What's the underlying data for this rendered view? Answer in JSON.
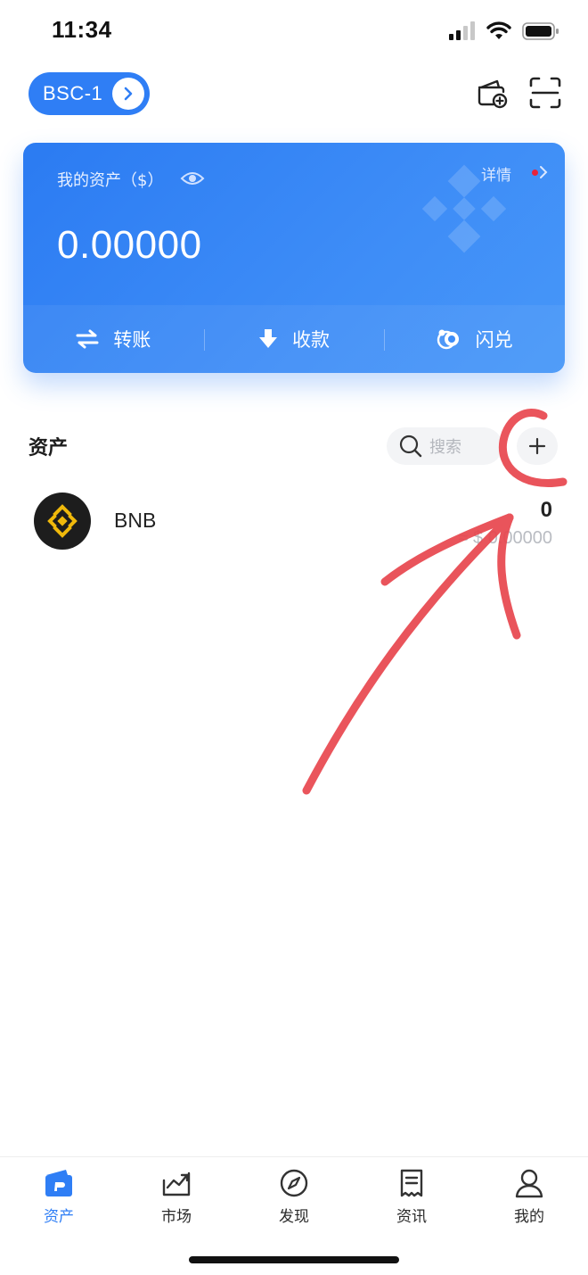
{
  "status_bar": {
    "time": "11:34"
  },
  "header": {
    "network": "BSC-1"
  },
  "asset_card": {
    "label": "我的资产（$）",
    "detail": "详情",
    "balance": "0.00000",
    "actions": [
      {
        "label": "转账",
        "icon": "transfer-icon"
      },
      {
        "label": "收款",
        "icon": "receive-icon"
      },
      {
        "label": "闪兑",
        "icon": "swap-icon"
      }
    ]
  },
  "assets": {
    "title": "资产",
    "search_placeholder": "搜索",
    "tokens": [
      {
        "name": "BNB",
        "amount": "0",
        "value": "≈ $ 0.00000"
      }
    ]
  },
  "tabs": [
    {
      "label": "资产",
      "icon": "wallet-icon",
      "active": true
    },
    {
      "label": "市场",
      "icon": "market-chart-icon",
      "active": false
    },
    {
      "label": "发现",
      "icon": "compass-icon",
      "active": false
    },
    {
      "label": "资讯",
      "icon": "news-icon",
      "active": false
    },
    {
      "label": "我的",
      "icon": "profile-icon",
      "active": false
    }
  ],
  "colors": {
    "accent": "#2f7ef5",
    "annotation": "#e8464e",
    "bnb_gold": "#f0b90b"
  }
}
